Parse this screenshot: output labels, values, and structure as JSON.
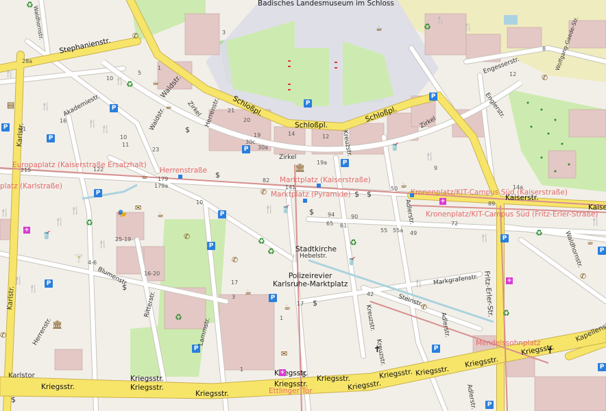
{
  "map": {
    "type": "OpenStreetMap street map",
    "colors": {
      "land": "#f2efe9",
      "building": "#e3c8c5",
      "building_edge": "#c9a9a6",
      "park": "#cdebb0",
      "green_area": "#addba3",
      "pedestrian": "#dddde8",
      "major_road": "#f7e56a",
      "major_road_edge": "#c9b04a",
      "minor_road": "#ffffff",
      "tram": "#d88f8f",
      "water": "#aad3df",
      "residential_light": "#efecc0"
    },
    "landmarks": [
      {
        "id": "museum",
        "text": "Badisches Landesmuseum im Schloss"
      },
      {
        "id": "stadtkirche",
        "text": "Stadtkirche"
      },
      {
        "id": "polizeirevier",
        "text": "Polizeirevier\nKarlsruhe-Marktplatz"
      }
    ],
    "stops": [
      {
        "id": "europaplatz",
        "text": "Europaplatz (Kaiserstraße Ersatzhalt)"
      },
      {
        "id": "herrenstrasse_stop",
        "text": "Herrenstraße"
      },
      {
        "id": "marktplatz_kaiser",
        "text": "Marktplatz (Kaiserstraße)"
      },
      {
        "id": "marktplatz_pyramide",
        "text": "Marktplatz (Pyramide)"
      },
      {
        "id": "kronenplatz_kaiser",
        "text": "Kronenplatz/KIT-Campus Süd (Kaiserstraße)"
      },
      {
        "id": "kronenplatz_fritz",
        "text": "Kronenplatz/KIT-Campus Süd (Fritz-Erler-Straße)"
      },
      {
        "id": "karlsruhe_kaiser",
        "text": "platz (Karlstraße)"
      },
      {
        "id": "mendelssohnplatz",
        "text": "Mendelssohnplatz"
      },
      {
        "id": "ettlinger_tor",
        "text": "Ettlinger Tor"
      }
    ],
    "streets": [
      {
        "id": "waldhornstr_top",
        "text": "Waldhornstr."
      },
      {
        "id": "stephanienstr",
        "text": "Stephanienstr."
      },
      {
        "id": "akademiestr",
        "text": "Akademiestr."
      },
      {
        "id": "waldstr_a",
        "text": "Waldstr."
      },
      {
        "id": "waldstr_b",
        "text": "Waldstr."
      },
      {
        "id": "zirkel_a",
        "text": "Zirkel"
      },
      {
        "id": "herrenstr_a",
        "text": "Herrenstr."
      },
      {
        "id": "schlossplatz_a",
        "text": "Schloßpl."
      },
      {
        "id": "schlossplatz_b",
        "text": "Schloßpl."
      },
      {
        "id": "schlossplatz_c",
        "text": "Schloßpl."
      },
      {
        "id": "zirkel_b",
        "text": "Zirkel"
      },
      {
        "id": "zirkel_c",
        "text": "Zirkel"
      },
      {
        "id": "kreuzstr_a",
        "text": "Kreuzstr."
      },
      {
        "id": "kreuzstr_b",
        "text": "Kreuzstr."
      },
      {
        "id": "kreuzstr_c",
        "text": "Kreuzstr."
      },
      {
        "id": "adlerstr_a",
        "text": "Adlerstr."
      },
      {
        "id": "adlerstr_b",
        "text": "Adlerstr."
      },
      {
        "id": "adlerstr_c",
        "text": "Adlerstr."
      },
      {
        "id": "kaiserstr",
        "text": "Kaiserstr."
      },
      {
        "id": "kaiserstr_b",
        "text": "Kaiser"
      },
      {
        "id": "hebelstr",
        "text": "Hebelstr."
      },
      {
        "id": "markgrafenstr",
        "text": "Markgrafenstr."
      },
      {
        "id": "steinstr",
        "text": "Steinstr."
      },
      {
        "id": "fritz_erler",
        "text": "Fritz-Erler-Str."
      },
      {
        "id": "waldhornstr",
        "text": "Waldhornstr."
      },
      {
        "id": "kapellenstr",
        "text": "Kapellenstr."
      },
      {
        "id": "kriegsstr_1",
        "text": "Kriegsstr."
      },
      {
        "id": "kriegsstr_2",
        "text": "Kriegsstr."
      },
      {
        "id": "kriegsstr_3",
        "text": "Kriegsstr."
      },
      {
        "id": "kriegsstr_4",
        "text": "Kriegsstr."
      },
      {
        "id": "kriegsstr_5",
        "text": "Kriegsstr."
      },
      {
        "id": "kriegsstr_6",
        "text": "Kriegsstr."
      },
      {
        "id": "kriegsstr_7",
        "text": "Kriegsstr."
      },
      {
        "id": "kriegsstr_8",
        "text": "Kriegsstr."
      },
      {
        "id": "kriegsstr_9",
        "text": "Kriegsstr."
      },
      {
        "id": "kriegsstr_10",
        "text": "Kriegsstr."
      },
      {
        "id": "kriegsstr_11",
        "text": "Kriegsstr."
      },
      {
        "id": "kriegsstr_12",
        "text": "Kriegsstr."
      },
      {
        "id": "karlstr_a",
        "text": "Karlstr."
      },
      {
        "id": "karlstr_b",
        "text": "Karlstr."
      },
      {
        "id": "karlstor",
        "text": "Karlstor"
      },
      {
        "id": "herrenstr_b",
        "text": "Herrenstr."
      },
      {
        "id": "blumenstr",
        "text": "Blumenstr."
      },
      {
        "id": "ritterstr",
        "text": "Ritterstr."
      },
      {
        "id": "lammstr",
        "text": "Lammstr."
      },
      {
        "id": "engesserstr",
        "text": "Engesserstr."
      },
      {
        "id": "englerstr",
        "text": "Englerstr."
      },
      {
        "id": "wolfgang_gaede",
        "text": "Wolfgang-Gaede-Str."
      },
      {
        "id": "zirkel_d",
        "text": "Zirkel"
      },
      {
        "id": "schlossplatz_label",
        "text": "Schloßpl."
      }
    ],
    "house_numbers": [
      "28a",
      "10",
      "5",
      "1",
      "4",
      "3",
      "2",
      "13",
      "36",
      "41",
      "16",
      "27",
      "10",
      "11",
      "23",
      "10",
      "21",
      "20",
      "19",
      "14",
      "12",
      "30c",
      "30a",
      "19a",
      "22",
      "14a",
      "89",
      "38",
      "34",
      "215",
      "179",
      "179a",
      "122",
      "82",
      "141",
      "50",
      "4",
      "31",
      "39",
      "38",
      "37",
      "40",
      "29",
      "30",
      "10",
      "7",
      "6",
      "94",
      "65",
      "90",
      "61",
      "55",
      "55a",
      "49",
      "72",
      "10",
      "25-19",
      "4-6",
      "12",
      "14",
      "16-20",
      "9",
      "17",
      "3",
      "17",
      "42",
      "1",
      "1",
      "9",
      "8",
      "9",
      "12",
      "3",
      "2",
      "5",
      "18",
      "9",
      "14",
      "24",
      "23"
    ],
    "icon_names": [
      "cafe-icon",
      "restaurant-icon",
      "parking-icon",
      "pharmacy-icon",
      "bank-icon",
      "recycling-icon",
      "museum-icon",
      "church-icon",
      "phone-icon",
      "theatre-icon",
      "post-icon",
      "bar-icon",
      "fast-food-icon"
    ]
  }
}
